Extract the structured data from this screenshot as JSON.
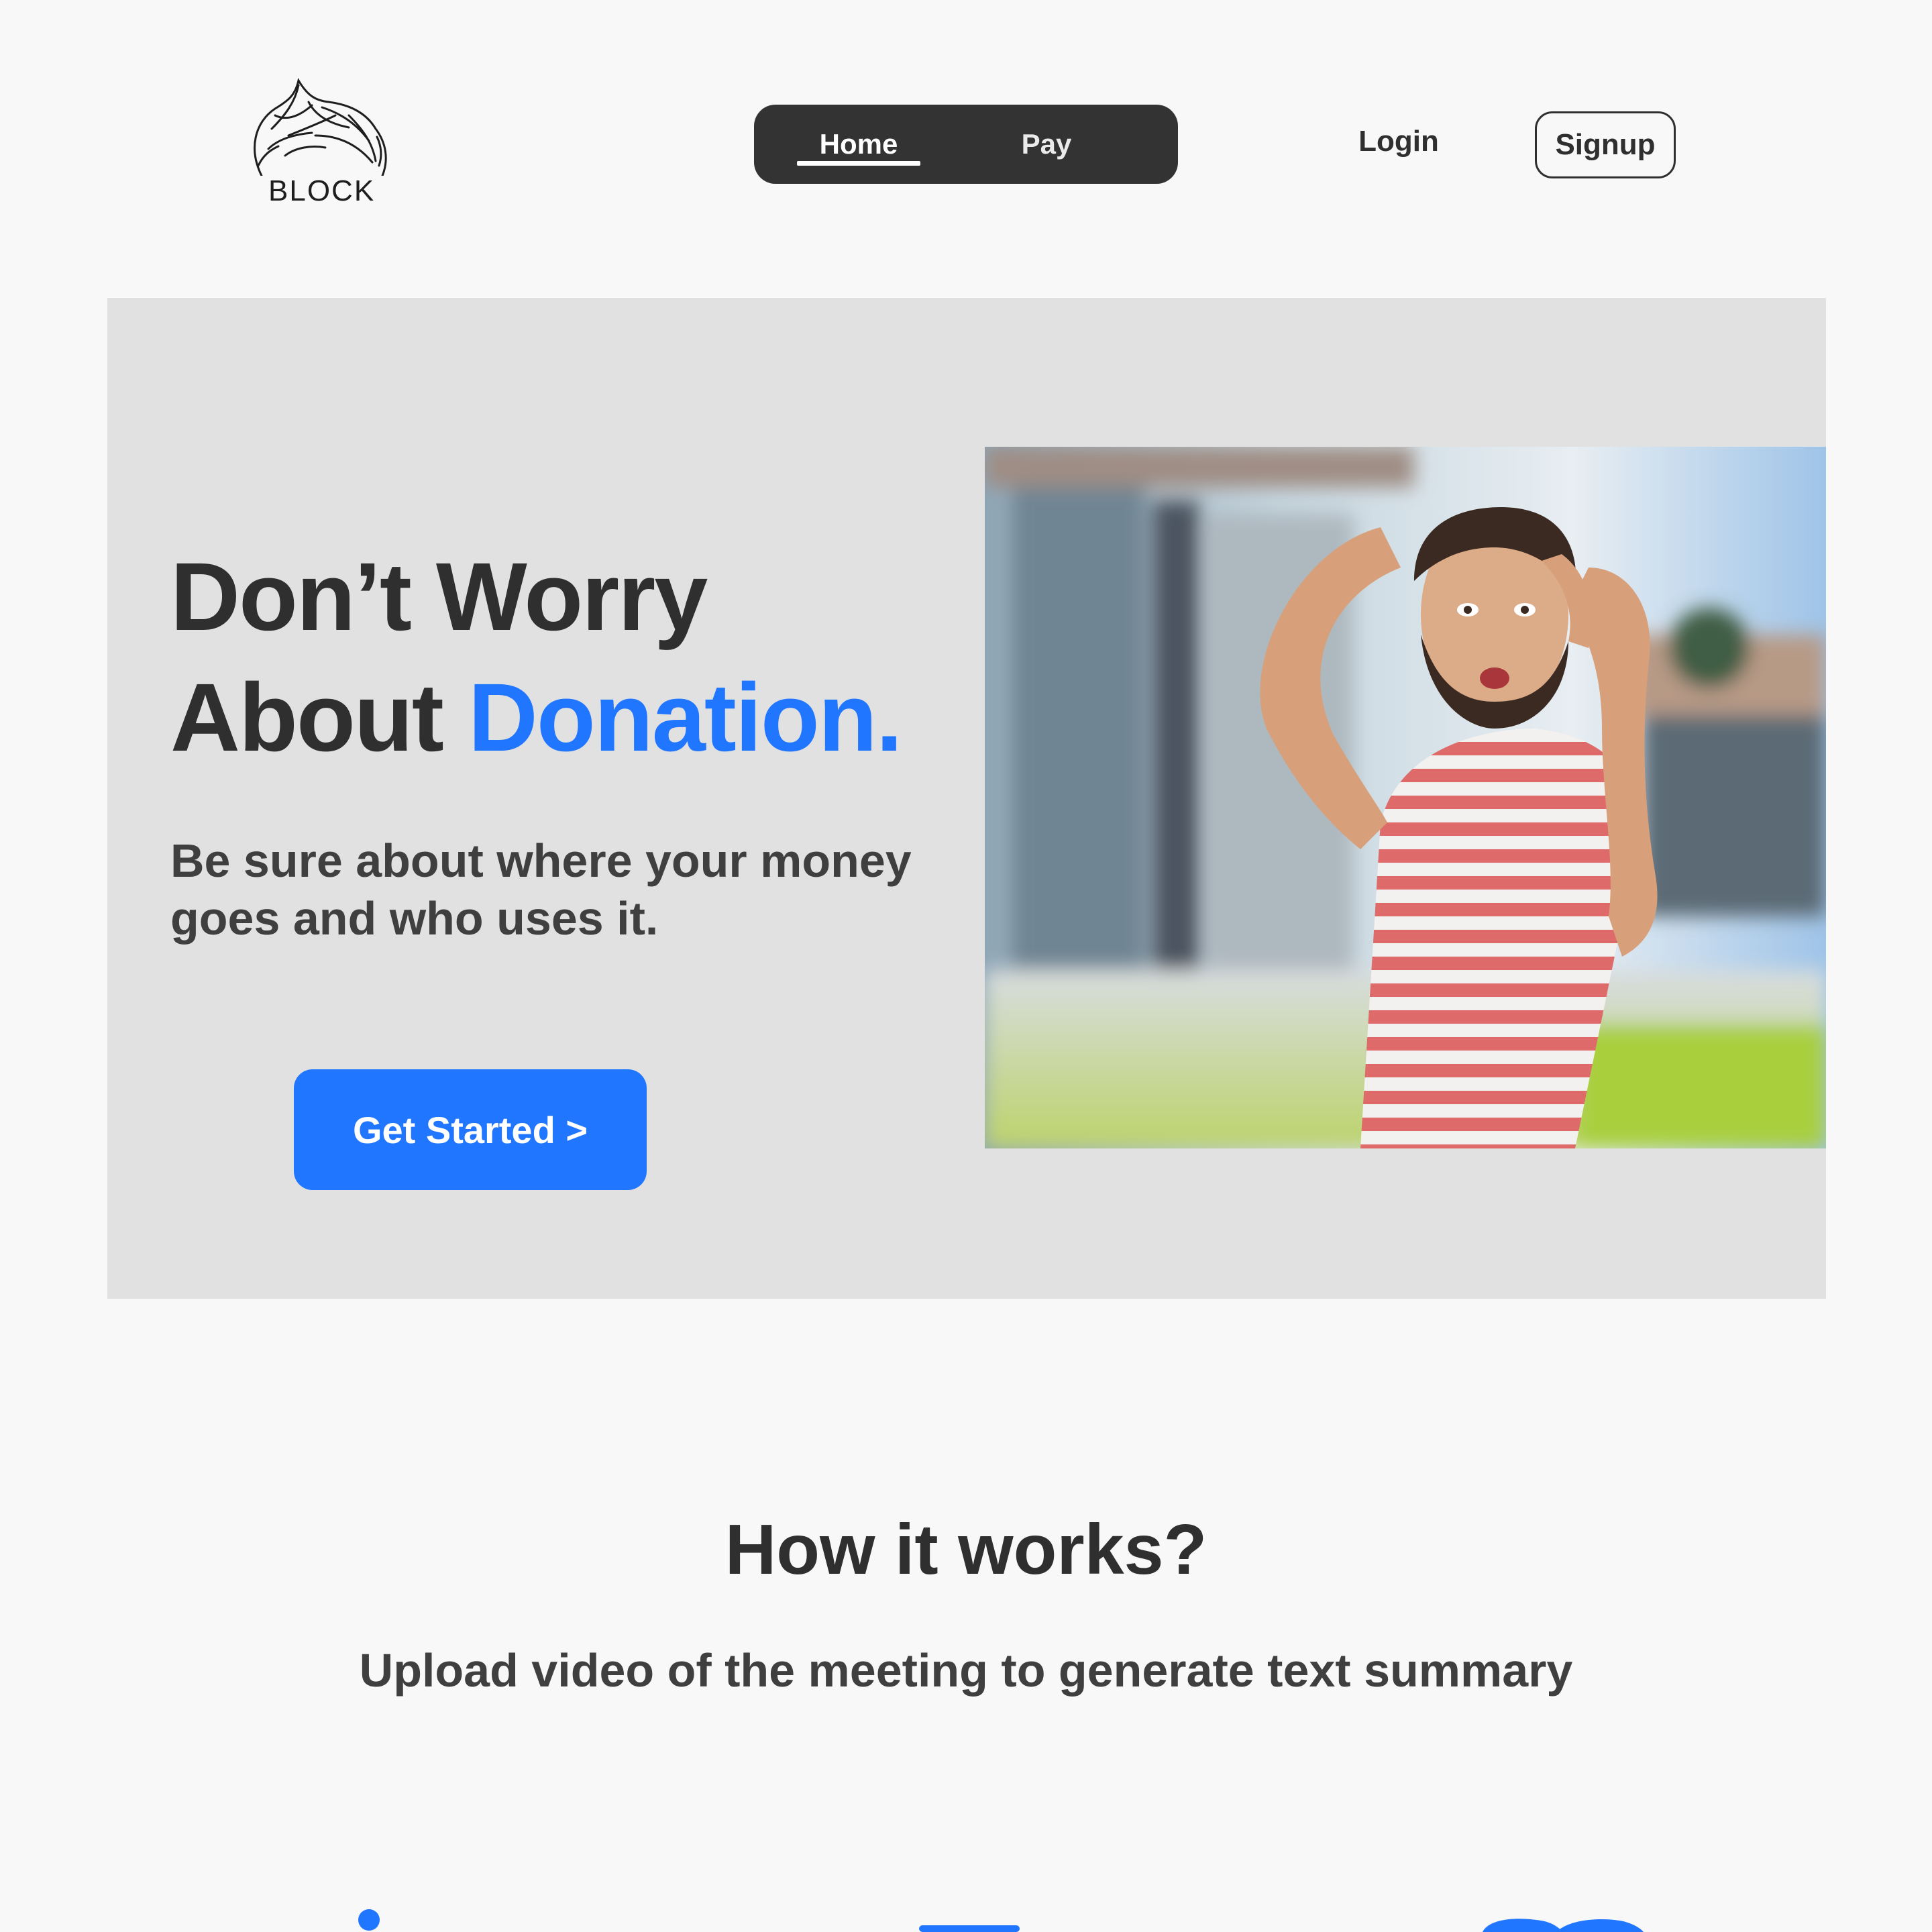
{
  "brand": {
    "logo_text": "BLOCK",
    "accent_color": "#2176ff",
    "dark_color": "#333333"
  },
  "nav": {
    "home_label": "Home",
    "pay_label": "Pay",
    "active": "Home"
  },
  "auth": {
    "login_label": "Login",
    "signup_label": "Signup"
  },
  "hero": {
    "title_line1": "Don’t Worry",
    "title_line2_prefix": "About ",
    "title_line2_accent": "Donation.",
    "subtitle": "Be sure about where your money goes and who uses it.",
    "cta_label": "Get Started >",
    "photo_icon": "worried-man-photo"
  },
  "how_it_works": {
    "title": "How it works?",
    "subtitle": "Upload video of the meeting to generate text summary",
    "steps": [
      {
        "icon": "info-icon"
      },
      {
        "icon": "document-icon"
      },
      {
        "icon": "people-icon"
      }
    ]
  }
}
